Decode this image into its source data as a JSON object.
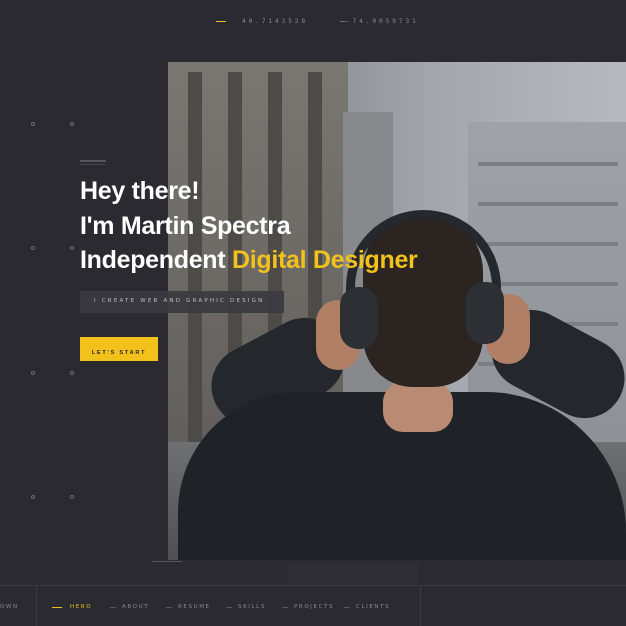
{
  "topbar": {
    "latitude": "40.7143528",
    "longitude": "-74.0059731"
  },
  "hero": {
    "line1": "Hey there!",
    "line2": "I'm Martin Spectra",
    "line3_prefix": "Independent ",
    "line3_accent": "Digital Designer",
    "tagline": "I CREATE WEB AND GRAPHIC DESIGN",
    "cta_label": "LET'S START"
  },
  "nav": {
    "scroll_label": "OWN",
    "items": [
      {
        "label": "HERO"
      },
      {
        "label": "ABOUT"
      },
      {
        "label": "RESUME"
      },
      {
        "label": "SKILLS"
      },
      {
        "label": "PROJECTS"
      },
      {
        "label": "CLIENTS"
      }
    ]
  },
  "colors": {
    "background": "#2a2a30",
    "accent": "#f2c11c",
    "text": "#ffffff",
    "muted": "#8b8b93"
  },
  "icons": {
    "photo": "man-with-headphones-photo"
  }
}
